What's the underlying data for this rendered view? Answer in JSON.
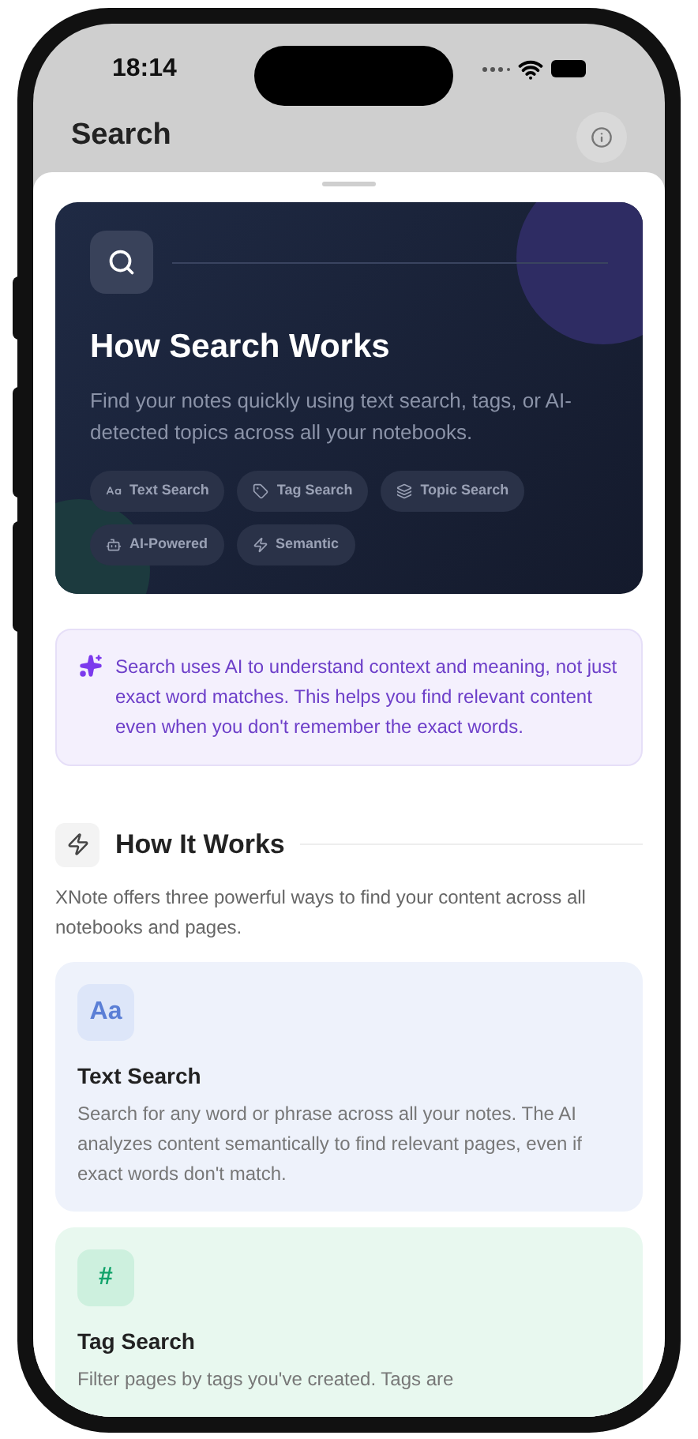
{
  "status_bar": {
    "time": "18:14"
  },
  "header": {
    "title": "Search"
  },
  "hero": {
    "title": "How Search Works",
    "description": "Find your notes quickly using text search, tags, or AI-detected topics across all your notebooks.",
    "chips": [
      {
        "kind": "text",
        "label": "Text Search"
      },
      {
        "kind": "tag",
        "label": "Tag Search"
      },
      {
        "kind": "topic",
        "label": "Topic Search"
      },
      {
        "kind": "ai",
        "label": "AI-Powered"
      },
      {
        "kind": "semantic",
        "label": "Semantic"
      }
    ]
  },
  "ai_note": {
    "text": "Search uses AI to understand context and meaning, not just exact word matches. This helps you find relevant content even when you don't remember the exact words."
  },
  "how_it_works": {
    "title": "How It Works",
    "description": "XNote offers three powerful ways to find your content across all notebooks and pages.",
    "features": [
      {
        "kind": "text",
        "glyph": "Aa",
        "color": "#5b7fd6",
        "title": "Text Search",
        "description": "Search for any word or phrase across all your notes. The AI analyzes content semantically to find relevant pages, even if exact words don't match."
      },
      {
        "kind": "tag",
        "glyph": "#",
        "color": "#10a36a",
        "title": "Tag Search",
        "description": "Filter pages by tags you've created. Tags are"
      }
    ]
  }
}
